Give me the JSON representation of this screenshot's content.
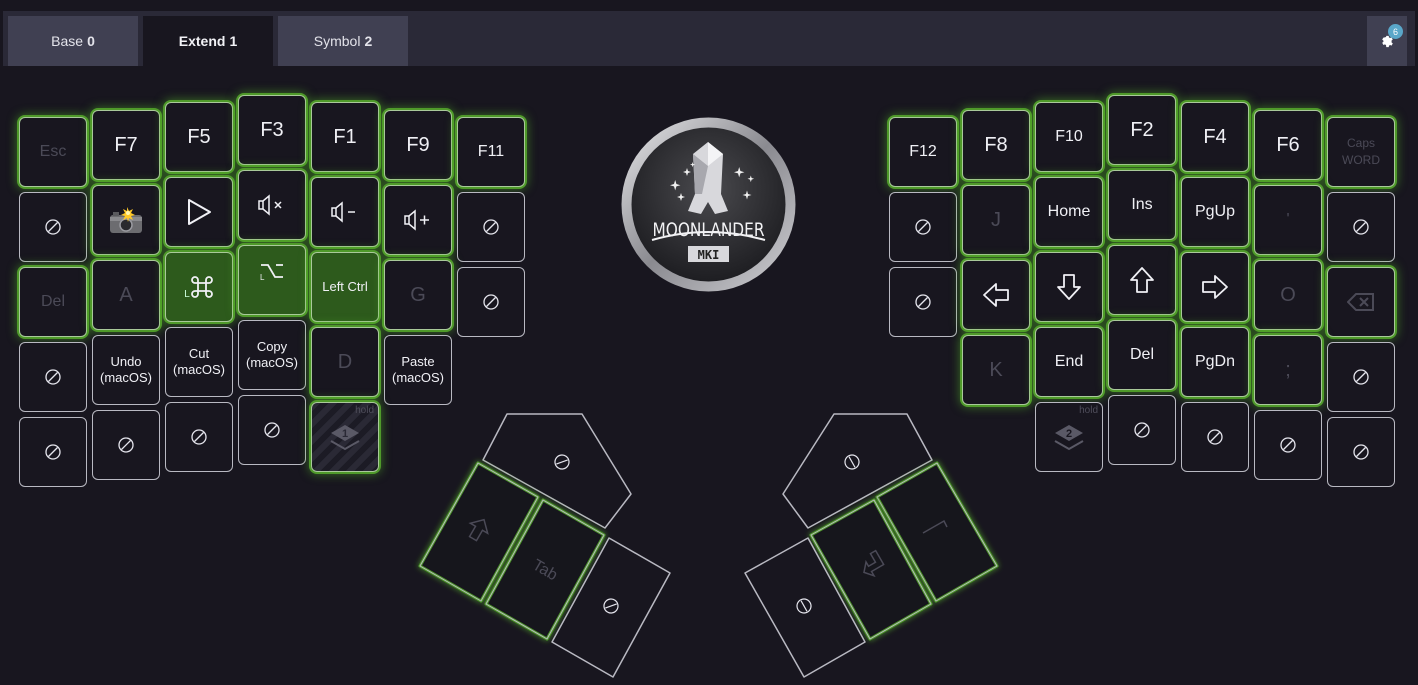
{
  "tabs": [
    {
      "name": "Base",
      "index": "0",
      "active": false
    },
    {
      "name": "Extend",
      "index": "1",
      "active": true
    },
    {
      "name": "Symbol",
      "index": "2",
      "active": false
    }
  ],
  "settings": {
    "icon": "gear-icon",
    "badge_count": "6"
  },
  "colors": {
    "background": "#18161f",
    "topbar": "#2a2937",
    "tab": "#404052",
    "glow": "#4f9a2a",
    "active_key": "#2d5a1c",
    "badge": "#5aa7c9"
  },
  "logo": {
    "text": "MOONLANDER",
    "model": "MKI"
  },
  "left_hand": {
    "row0": [
      "Esc",
      "F7",
      "F5",
      "F3",
      "F1",
      "F9",
      "F11"
    ],
    "row1": [
      "none",
      "screenshot",
      "play",
      "mute",
      "volume-down",
      "volume-up",
      "none"
    ],
    "row2": [
      "Del",
      "A",
      "Left Cmd",
      "Left Option",
      "Left Ctrl",
      "G",
      "none"
    ],
    "row3": [
      "none",
      "Undo (macOS)",
      "Cut (macOS)",
      "Copy (macOS)",
      "D"
    ],
    "row4": [
      "none",
      "none",
      "none",
      "none",
      "layer-1-hold"
    ],
    "labels": {
      "undo": [
        "Undo",
        "(macOS)"
      ],
      "cut": [
        "Cut",
        "(macOS)"
      ],
      "copy": [
        "Copy",
        "(macOS)"
      ],
      "left_ctrl": "Left Ctrl",
      "cmd_prefix": "L",
      "opt_prefix": "L",
      "hold": "hold",
      "layer": "1"
    },
    "thumb": {
      "red": "none",
      "k1": "Shift",
      "k2": "Tab",
      "k3": "none"
    }
  },
  "right_hand": {
    "row0": [
      "F12",
      "F8",
      "F10",
      "F2",
      "F4",
      "F6",
      "Caps WORD"
    ],
    "row1": [
      "none",
      "J",
      "Home",
      "Ins",
      "PgUp",
      "'",
      "none"
    ],
    "row2": [
      "none",
      "left-arrow",
      "down-arrow",
      "up-arrow",
      "right-arrow",
      "O",
      "backspace"
    ],
    "row3": [
      "K",
      "End",
      "Del",
      "PgDn",
      ";",
      "none"
    ],
    "row4": [
      "layer-2-hold",
      "none",
      "none",
      "none",
      "none"
    ],
    "labels": {
      "caps": [
        "Caps",
        "WORD"
      ],
      "hold": "hold",
      "layer": "2"
    },
    "thumb": {
      "red": "none",
      "k1": "Space",
      "k2": "Enter",
      "k3": "none"
    }
  }
}
